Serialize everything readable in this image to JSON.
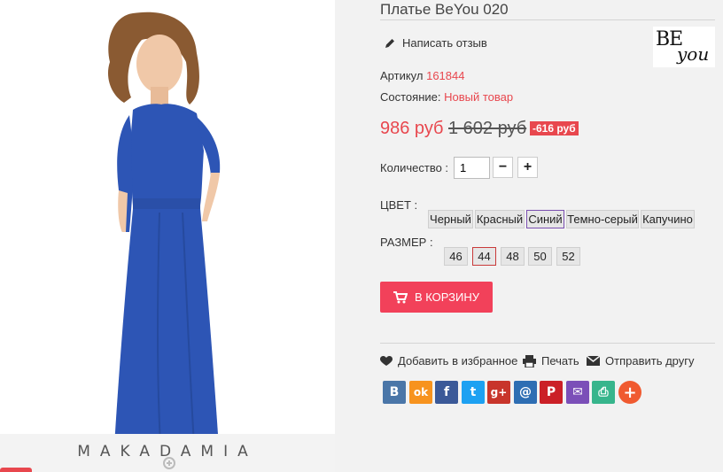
{
  "product": {
    "title": "Платье BeYou 020",
    "write_review": "Написать отзыв",
    "sku_label": "Артикул",
    "sku_value": "161844",
    "condition_label": "Состояние:",
    "condition_value": "Новый товар",
    "price": "986 руб",
    "old_price": "1 602 руб",
    "discount": "-616 руб"
  },
  "photo": {
    "brand_watermark": "MAKADAMIA"
  },
  "brand_logo": {
    "be": "BE",
    "you": "you"
  },
  "quantity": {
    "label": "Количество :",
    "value": "1",
    "minus": "−",
    "plus": "+"
  },
  "options": {
    "color_label": "ЦВЕТ :",
    "colors": [
      "Черный",
      "Красный",
      "Синий",
      "Темно-серый",
      "Капучино"
    ],
    "selected_color": "Синий",
    "size_label": "РАЗМЕР :",
    "sizes": [
      "46",
      "44",
      "48",
      "50",
      "52"
    ],
    "selected_size": "44"
  },
  "cart": {
    "label": "В КОРЗИНУ"
  },
  "actions": {
    "wishlist": "Добавить в избранное",
    "print": "Печать",
    "send": "Отправить другу"
  },
  "share": [
    {
      "name": "vk-icon",
      "glyph": "B",
      "color": "#4a76a8"
    },
    {
      "name": "odnoklassniki-icon",
      "glyph": "ok",
      "color": "#f7931e"
    },
    {
      "name": "facebook-icon",
      "glyph": "f",
      "color": "#3b5998"
    },
    {
      "name": "twitter-icon",
      "glyph": "t",
      "color": "#1da1f2"
    },
    {
      "name": "google-plus-icon",
      "glyph": "g+",
      "color": "#c8352b"
    },
    {
      "name": "mailru-icon",
      "glyph": "@",
      "color": "#2e6eb3"
    },
    {
      "name": "pinterest-icon",
      "glyph": "P",
      "color": "#cb2027"
    },
    {
      "name": "email-icon",
      "glyph": "✉",
      "color": "#7b4fb8"
    },
    {
      "name": "print-share-icon",
      "glyph": "⎙",
      "color": "#37b58c"
    },
    {
      "name": "more-share-icon",
      "glyph": "+",
      "color": "#f05a30"
    }
  ],
  "colors": {
    "accent": "#e8474e",
    "cart_button": "#f2415a",
    "dress": "#2d55b5"
  }
}
